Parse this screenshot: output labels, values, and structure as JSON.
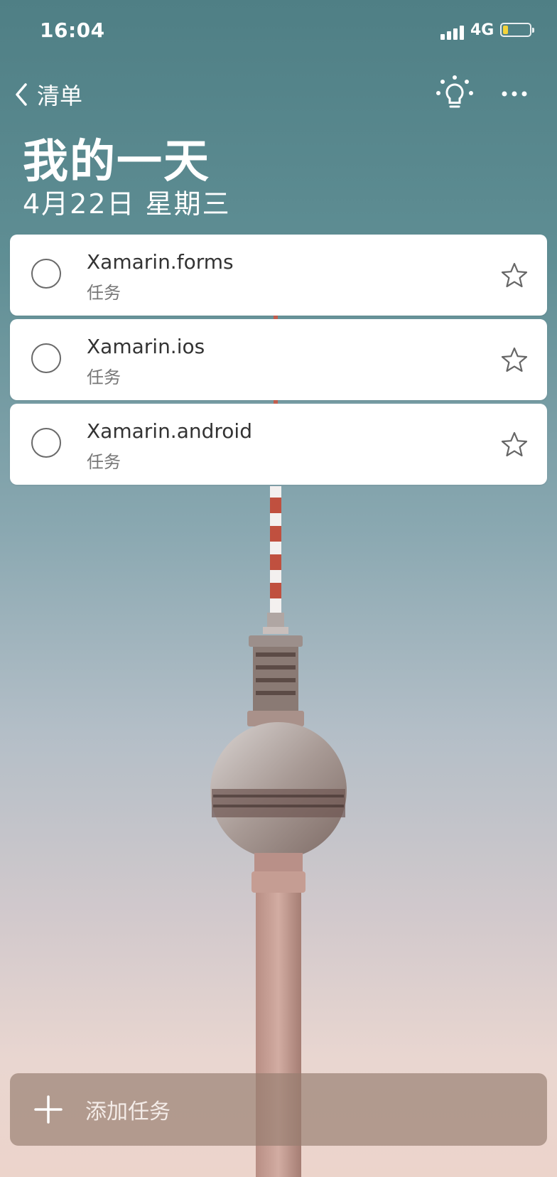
{
  "status_bar": {
    "time": "16:04",
    "network": "4G",
    "battery_level": 0.2
  },
  "nav": {
    "back_label": "清单",
    "icons": [
      "chevron-left-icon",
      "lightbulb-icon",
      "more-icon"
    ]
  },
  "header": {
    "title": "我的一天",
    "date": "4月22日 星期三"
  },
  "tasks": [
    {
      "name": "Xamarin.forms",
      "list": "任务",
      "completed": false,
      "starred": false
    },
    {
      "name": "Xamarin.ios",
      "list": "任务",
      "completed": false,
      "starred": false
    },
    {
      "name": "Xamarin.android",
      "list": "任务",
      "completed": false,
      "starred": false
    }
  ],
  "add_task": {
    "label": "添加任务",
    "icon": "plus-icon"
  },
  "colors": {
    "task_card": "#ffffff",
    "add_bar": "#967d70",
    "sky_top": "#4f7f85",
    "sky_bottom": "#ecd4cb"
  }
}
